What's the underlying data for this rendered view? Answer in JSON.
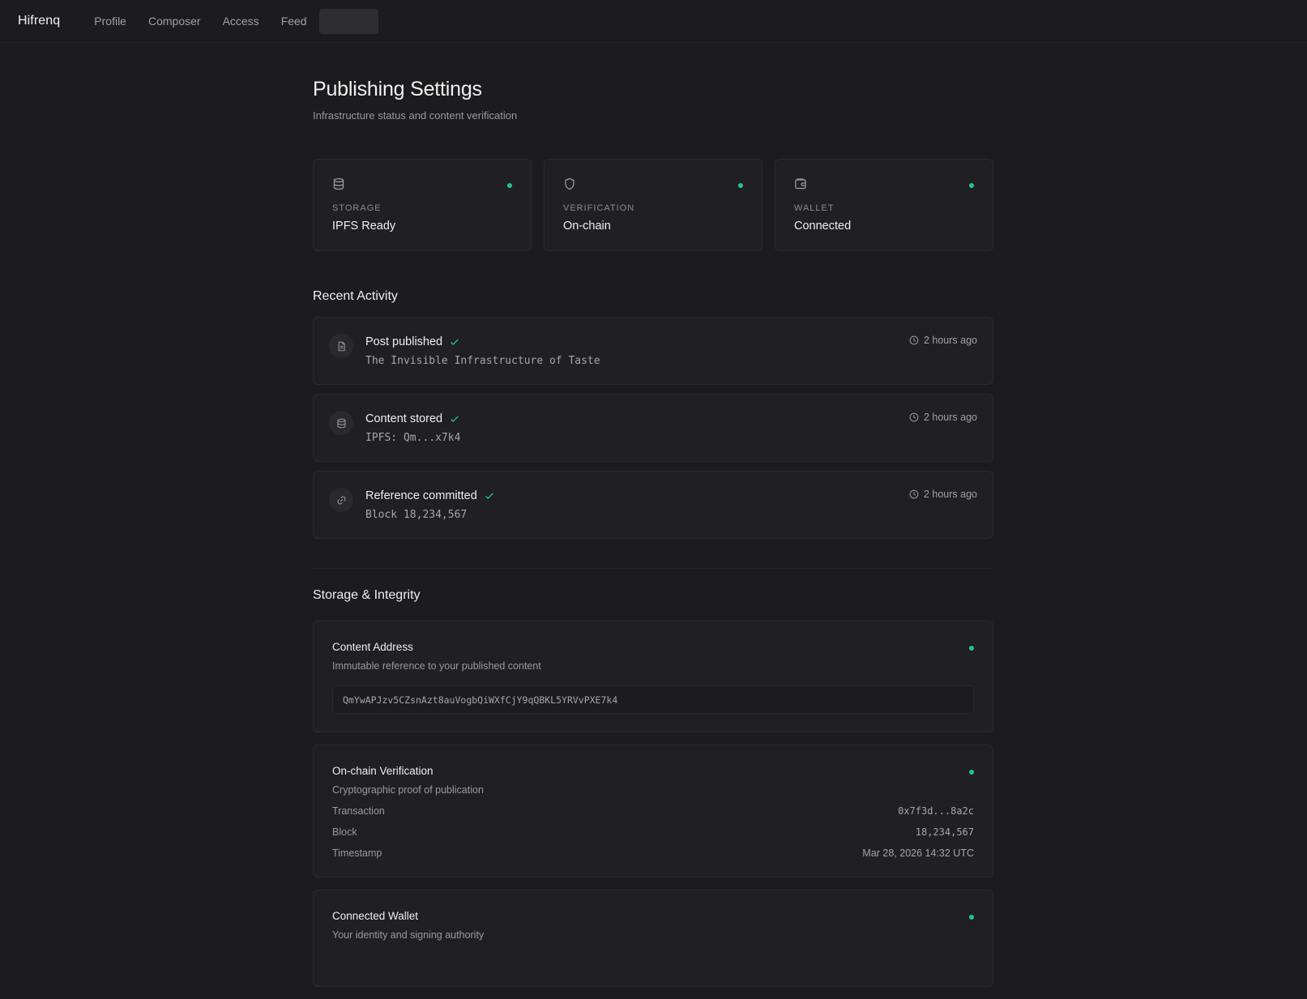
{
  "nav": {
    "brand": "Hifrenq",
    "items": [
      {
        "label": "Profile"
      },
      {
        "label": "Composer"
      },
      {
        "label": "Access"
      },
      {
        "label": "Feed"
      }
    ]
  },
  "header": {
    "title": "Publishing Settings",
    "subtitle": "Infrastructure status and content verification"
  },
  "status_cards": [
    {
      "icon": "database-icon",
      "label": "STORAGE",
      "value": "IPFS Ready",
      "status_color": "#22c58b"
    },
    {
      "icon": "shield-icon",
      "label": "VERIFICATION",
      "value": "On-chain",
      "status_color": "#22c58b"
    },
    {
      "icon": "wallet-icon",
      "label": "WALLET",
      "value": "Connected",
      "status_color": "#22c58b"
    }
  ],
  "activity": {
    "title": "Recent Activity",
    "items": [
      {
        "icon": "document-icon",
        "title": "Post published",
        "detail": "The Invisible Infrastructure of Taste",
        "time": "2 hours ago"
      },
      {
        "icon": "database-icon",
        "title": "Content stored",
        "detail": "IPFS: Qm...x7k4",
        "time": "2 hours ago"
      },
      {
        "icon": "link-icon",
        "title": "Reference committed",
        "detail": "Block 18,234,567",
        "time": "2 hours ago"
      }
    ]
  },
  "storage": {
    "title": "Storage & Integrity",
    "content_address": {
      "title": "Content Address",
      "description": "Immutable reference to your published content",
      "value": "QmYwAPJzv5CZsnAzt8auVogbQiWXfCjY9qQBKL5YRVvPXE7k4"
    },
    "verification": {
      "title": "On-chain Verification",
      "description": "Cryptographic proof of publication",
      "rows": [
        {
          "key": "Transaction",
          "value": "0x7f3d...8a2c"
        },
        {
          "key": "Block",
          "value": "18,234,567"
        },
        {
          "key": "Timestamp",
          "value": "Mar 28, 2026 14:32 UTC"
        }
      ]
    },
    "wallet": {
      "title": "Connected Wallet",
      "description": "Your identity and signing authority"
    }
  },
  "colors": {
    "accent": "#22c58b",
    "background": "#1c1c1e",
    "card": "#202022"
  }
}
